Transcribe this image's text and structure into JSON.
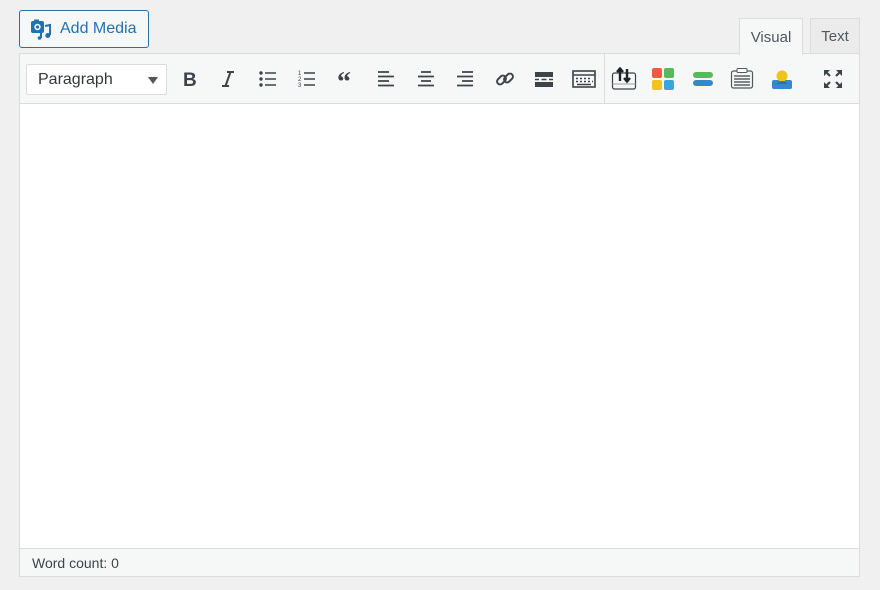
{
  "media": {
    "add_label": "Add Media"
  },
  "tabs": [
    {
      "label": "Visual"
    },
    {
      "label": "Text"
    }
  ],
  "toolbar": {
    "format_value": "Paragraph",
    "buttons": [
      "bold-icon",
      "italic-icon",
      "bulleted-list-icon",
      "numbered-list-icon",
      "blockquote-icon",
      "align-left-icon",
      "align-center-icon",
      "align-right-icon",
      "link-icon",
      "read-more-icon",
      "toolbar-toggle-icon",
      "plugin-insert-icon",
      "plugin-grid-icon",
      "plugin-stack-icon",
      "plugin-table-icon",
      "plugin-user-icon",
      "fullscreen-icon"
    ]
  },
  "status": {
    "word_count": "Word count: 0"
  },
  "colors": {
    "accent": "#2271b1",
    "icon": "#3c434a"
  }
}
